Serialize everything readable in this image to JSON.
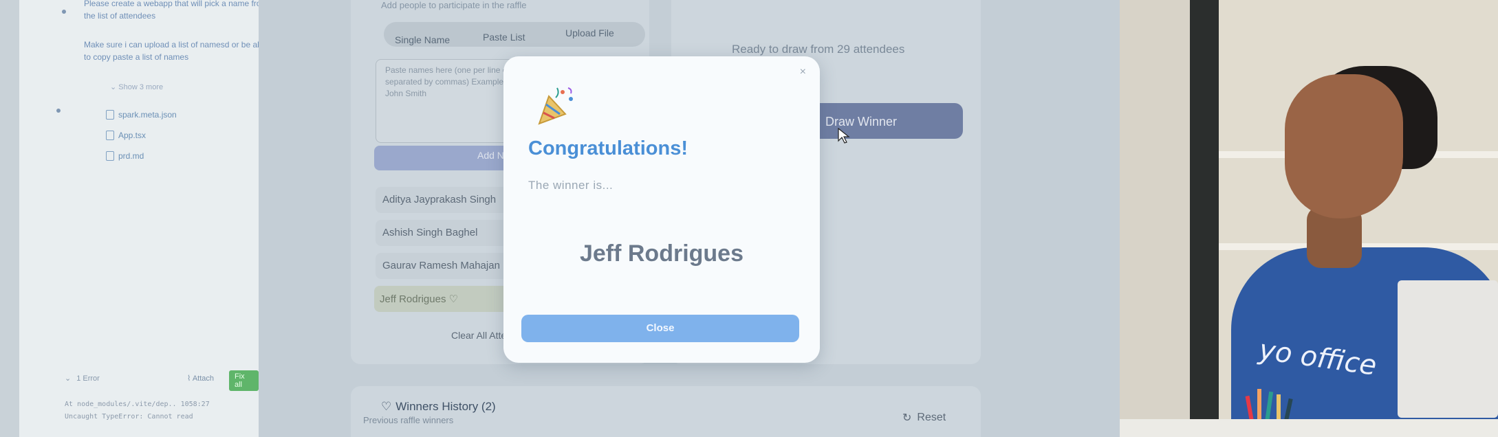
{
  "chat": {
    "message_1": "Please create a webapp that will pick a name from the list of attendees",
    "message_2": "Make sure i can upload a list of namesd or be able to copy paste a list of names",
    "show_files": "Show 3 more",
    "files": [
      "spark.meta.json",
      "App.tsx",
      "prd.md"
    ],
    "error_count": "1 Error",
    "attach_label": "Attach",
    "fix_all_label": "Fix all",
    "error_line_1": "At node_modules/.vite/dep.. 1058:27",
    "error_line_2": "Uncaught TypeError: Cannot read"
  },
  "participants": {
    "subtitle": "Add people to participate in the raffle",
    "tabs": [
      "Single Name",
      "Paste List",
      "Upload File"
    ],
    "textarea_placeholder": "Paste names here (one per line or separated by commas) Example: John Smith",
    "add_button": "Add Names",
    "attendees": [
      "Aditya Jayprakash Singh",
      "Ashish Singh Baghel",
      "Gaurav Ramesh Mahajan",
      "Jeff Rodrigues"
    ],
    "clear_all": "Clear All Attendees"
  },
  "draw": {
    "ready_text": "Ready to draw from 29 attendees",
    "draw_button": "Draw Winner"
  },
  "history": {
    "title": "Winners History (2)",
    "subtitle": "Previous raffle winners",
    "reset": "Reset"
  },
  "modal": {
    "title": "Congratulations!",
    "winner_is": "The winner is...",
    "winner_name": "Jeff Rodrigues",
    "close_button": "Close",
    "close_x": "×"
  },
  "room": {
    "shirt_text": "yo office"
  },
  "colors": {
    "accent": "#4a8fd6",
    "close_button": "#7fb2ec",
    "fix_all": "#5fb56a",
    "shirt": "#2f5aa3"
  }
}
